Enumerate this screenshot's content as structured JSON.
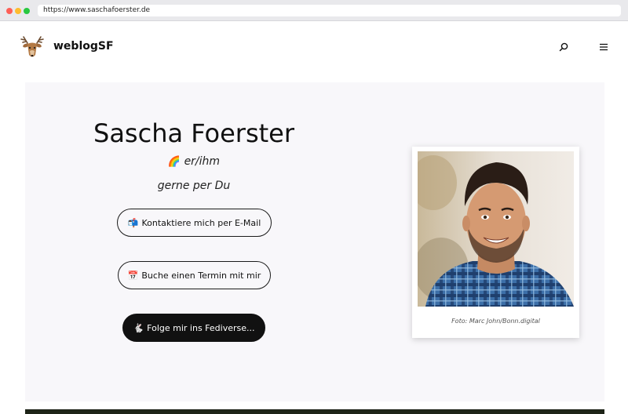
{
  "browser": {
    "url": "https://www.saschafoerster.de"
  },
  "header": {
    "logo_icon": "deer-head-icon",
    "brand": "weblogSF",
    "search_icon": "search-icon",
    "menu_icon": "hamburger-menu-icon"
  },
  "hero": {
    "name": "Sascha Foerster",
    "pronoun_emoji": "🌈",
    "pronoun": "er/ihm",
    "informal": "gerne per Du",
    "buttons": {
      "email": {
        "emoji": "📬",
        "label": "Kontaktiere mich per E-Mail"
      },
      "termin": {
        "emoji": "📅",
        "label": "Buche einen Termin mit mir"
      },
      "fediverse": {
        "emoji": "🐇",
        "label": "Folge mir ins Fediverse..."
      }
    }
  },
  "photo": {
    "caption": "Foto: Marc John/Bonn.digital"
  },
  "colors": {
    "hero_bg": "#f8f7fa",
    "primary_button": "#111111"
  }
}
